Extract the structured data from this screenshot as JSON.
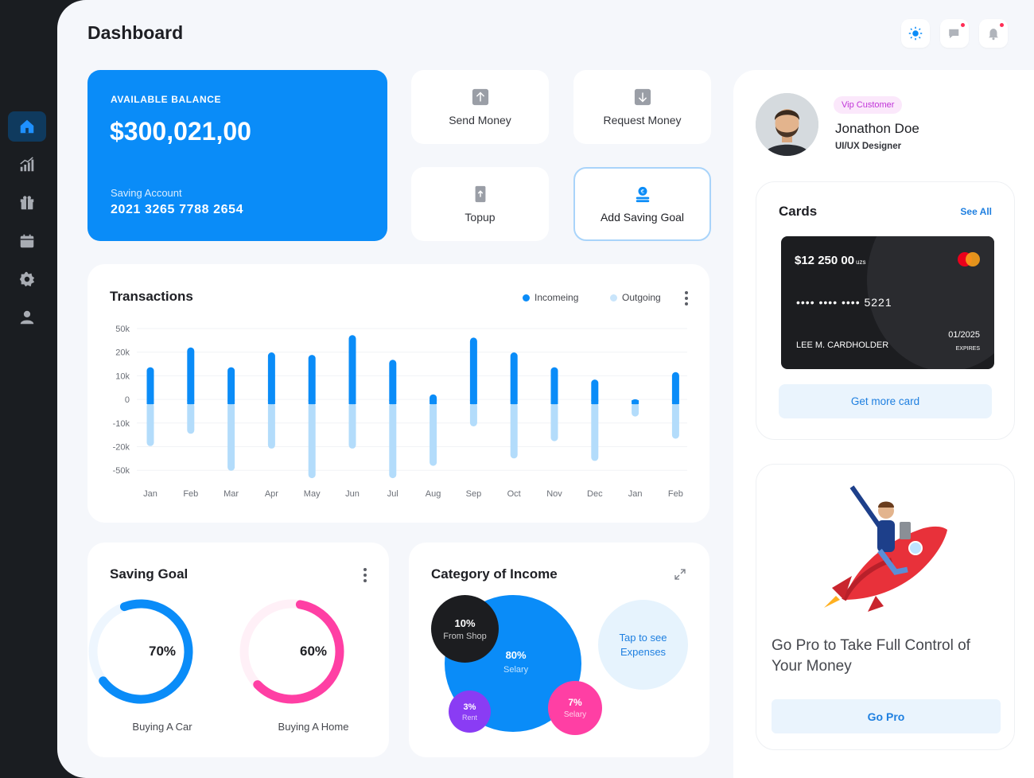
{
  "header": {
    "title": "Dashboard"
  },
  "balance": {
    "label": "AVAILABLE BALANCE",
    "amount": "$300,021,00",
    "account_label": "Saving Account",
    "account_number": "2021 3265 7788 2654"
  },
  "actions": {
    "send": "Send Money",
    "request": "Request Money",
    "topup": "Topup",
    "add_goal": "Add Saving Goal"
  },
  "transactions": {
    "title": "Transactions",
    "legend_in": "Incomeing",
    "legend_out": "Outgoing"
  },
  "chart_data": {
    "type": "bar",
    "title": "Transactions",
    "categories": [
      "Jan",
      "Feb",
      "Mar",
      "Apr",
      "May",
      "Jun",
      "Jul",
      "Aug",
      "Sep",
      "Oct",
      "Nov",
      "Dec",
      "Jan",
      "Feb"
    ],
    "y_tick_labels": [
      "50k",
      "20k",
      "10k",
      "0",
      "-10k",
      "-20k",
      "-50k"
    ],
    "series": [
      {
        "name": "Incomeing",
        "color": "#0a8cf8",
        "values": [
          15,
          23,
          15,
          21,
          20,
          28,
          18,
          4,
          27,
          21,
          15,
          10,
          2,
          13
        ]
      },
      {
        "name": "Outgoing",
        "color": "#b3dcfb",
        "values": [
          -17,
          -12,
          -27,
          -18,
          -30,
          -18,
          -30,
          -25,
          -9,
          -22,
          -15,
          -23,
          -5,
          -14
        ]
      }
    ],
    "grid": true,
    "legend": "top-right"
  },
  "saving": {
    "title": "Saving Goal",
    "goals": [
      {
        "percent": "70%",
        "label": "Buying A Car",
        "value": 0.7,
        "color": "#0a8cf8",
        "track": "#eef6fe"
      },
      {
        "percent": "60%",
        "label": "Buying A Home",
        "value": 0.6,
        "color": "#ff3fa4",
        "track": "#fff0f7"
      }
    ]
  },
  "category": {
    "title": "Category of Income",
    "shop": {
      "p": "10%",
      "s": "From Shop"
    },
    "salary": {
      "p": "80%",
      "s": "Selary"
    },
    "rent": {
      "p": "3%",
      "s": "Rent"
    },
    "selary2": {
      "p": "7%",
      "s": "Selary"
    },
    "tap": "Tap to see Expenses"
  },
  "profile": {
    "badge": "Vip Customer",
    "name": "Jonathon Doe",
    "role": "UI/UX Designer"
  },
  "cards": {
    "title": "Cards",
    "see_all": "See All",
    "balance": "$12 250 00",
    "currency": "uzs",
    "number": "•••• •••• •••• 5221",
    "holder": "LEE M. CARDHOLDER",
    "expiry": "01/2025",
    "expires_label": "EXPIRES",
    "get_more": "Get more card"
  },
  "promo": {
    "text": "Go Pro to Take Full Control of Your Money",
    "button": "Go Pro"
  }
}
